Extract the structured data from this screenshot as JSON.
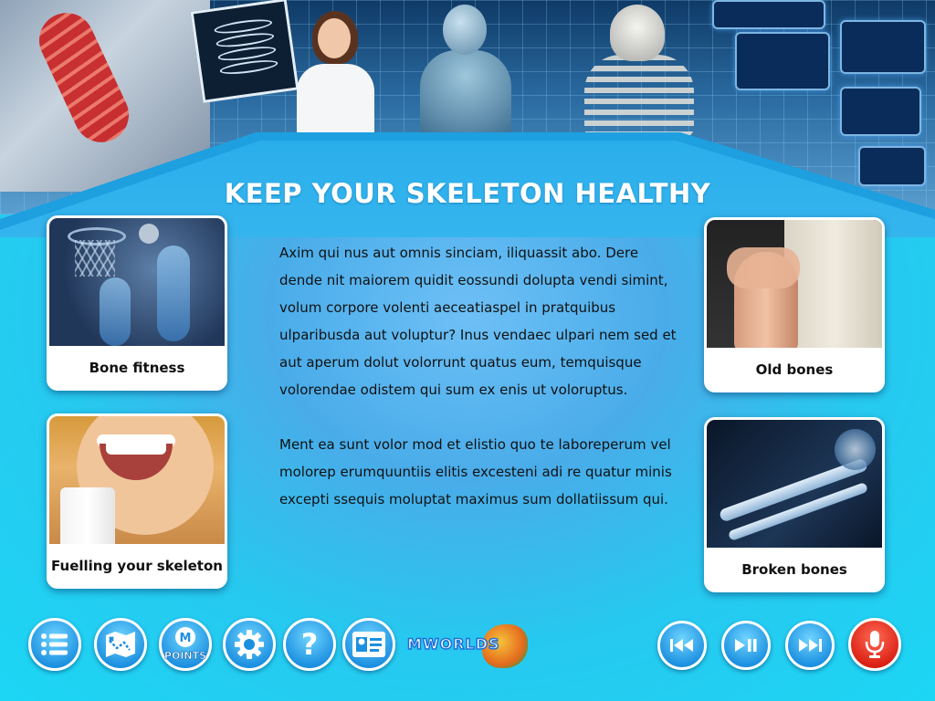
{
  "page": {
    "title": "KEEP YOUR SKELETON HEALTHY"
  },
  "cards": [
    {
      "label": "Bone fitness",
      "image": "basketball-xray"
    },
    {
      "label": "Fuelling your skeleton",
      "image": "milk-moustache"
    },
    {
      "label": "Old bones",
      "image": "knee-pain"
    },
    {
      "label": "Broken bones",
      "image": "arm-xray"
    }
  ],
  "body": {
    "paragraphs": [
      "Axim qui nus aut omnis sinciam, iliquassit abo. Dere dende nit maiorem quidit eossundi dolupta vendi simint, volum corpore volenti aeceatiaspel in pratquibus ulparibusda aut voluptur? Inus vendaec ulpari nem sed et aut aperum dolut volorrunt quatus eum, temquisque volorendae odistem qui sum ex enis ut voloruptus.",
      "Ment ea sunt volor mod et elistio quo te laboreperum vel molorep erumquuntiis elitis excesteni adi re quatur minis excepti ssequis moluptat maximus sum dollatiissum qui."
    ]
  },
  "toolbar": {
    "left": [
      {
        "name": "menu-button",
        "icon": "list-icon"
      },
      {
        "name": "map-button",
        "icon": "map-icon"
      },
      {
        "name": "points-button",
        "icon": "points-icon",
        "label": "POINTS"
      },
      {
        "name": "settings-button",
        "icon": "gear-icon"
      },
      {
        "name": "help-button",
        "icon": "question-icon"
      },
      {
        "name": "profile-button",
        "icon": "id-card-icon"
      }
    ],
    "logo_text": "MWORLDS",
    "right": [
      {
        "name": "rewind-button",
        "icon": "rewind-icon"
      },
      {
        "name": "play-pause-button",
        "icon": "play-pause-icon"
      },
      {
        "name": "fast-forward-button",
        "icon": "fast-forward-icon"
      },
      {
        "name": "microphone-button",
        "icon": "microphone-icon"
      }
    ]
  },
  "colors": {
    "accent": "#1b8fe0",
    "mic": "#d91f12",
    "background": "#2ec8ef"
  }
}
